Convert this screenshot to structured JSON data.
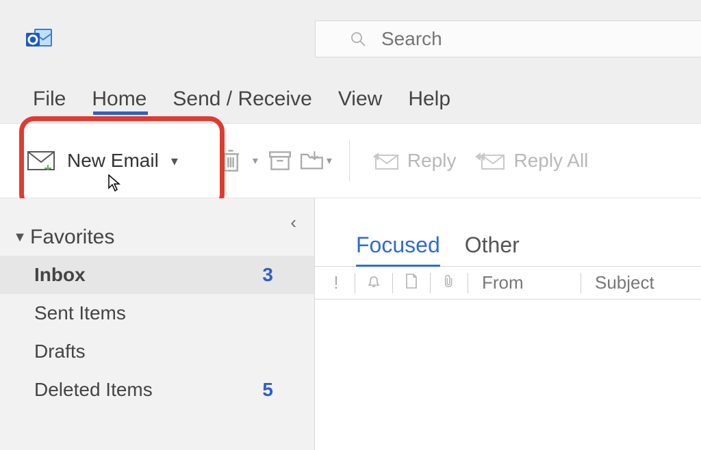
{
  "search": {
    "placeholder": "Search"
  },
  "menu": {
    "file": "File",
    "home": "Home",
    "send_receive": "Send / Receive",
    "view": "View",
    "help": "Help"
  },
  "ribbon": {
    "new_email": "New Email",
    "reply": "Reply",
    "reply_all": "Reply All"
  },
  "sidebar": {
    "favorites_header": "Favorites",
    "folders": [
      {
        "label": "Inbox",
        "count": "3",
        "active": true
      },
      {
        "label": "Sent Items",
        "count": ""
      },
      {
        "label": "Drafts",
        "count": ""
      },
      {
        "label": "Deleted Items",
        "count": "5"
      }
    ]
  },
  "main": {
    "tab_focused": "Focused",
    "tab_other": "Other",
    "col_from": "From",
    "col_subject": "Subject"
  }
}
